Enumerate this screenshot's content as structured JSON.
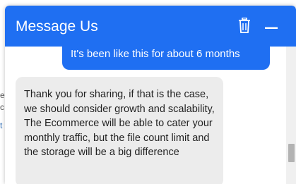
{
  "header": {
    "title": "Message Us",
    "trash_icon": "trash-icon",
    "minimize_icon": "minimize-icon",
    "background_color": "#1f6ff2"
  },
  "messages": [
    {
      "sender": "user",
      "text": "It's been like this for about 6 months"
    },
    {
      "sender": "agent",
      "text": "Thank you for sharing, if that is the case, we should consider growth and scalability, The Ecommerce will be able to cater your monthly traffic, but the file count limit and the storage will be a big difference"
    }
  ],
  "background_fragments": [
    "e",
    "c",
    "t"
  ]
}
